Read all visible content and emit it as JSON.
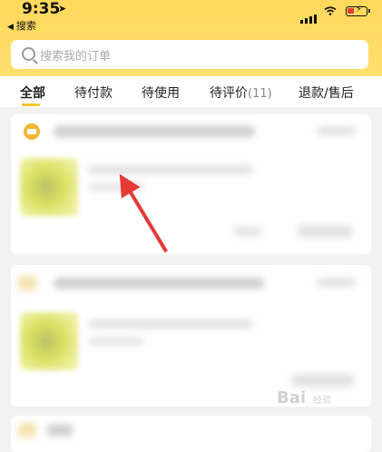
{
  "status_bar": {
    "time": "9:35",
    "back_label": "搜索"
  },
  "search": {
    "placeholder": "搜索我的订单"
  },
  "tabs": [
    {
      "label": "全部"
    },
    {
      "label": "待付款"
    },
    {
      "label": "待使用"
    },
    {
      "label": "待评价",
      "count": "(11)"
    },
    {
      "label": "退款/售后"
    }
  ],
  "watermark": {
    "text": "Bai",
    "sub": "经验"
  },
  "colors": {
    "header": "#ffd95c",
    "accent": "#f7c531",
    "arrow": "#e53935"
  }
}
